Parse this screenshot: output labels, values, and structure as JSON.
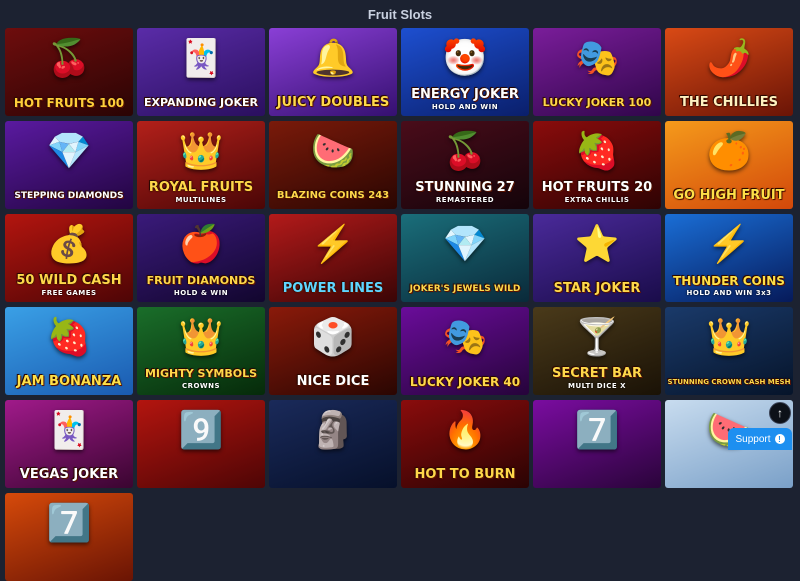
{
  "page": {
    "title": "Fruit Slots"
  },
  "games": [
    {
      "title": "HOT FRUITS 100",
      "subtitle": "",
      "icon": "🍒",
      "bg": "linear-gradient(160deg,#6e0d0d,#2a0404)",
      "color": "#ffcf3a"
    },
    {
      "title": "EXPANDING JOKER",
      "subtitle": "",
      "icon": "🃏",
      "bg": "linear-gradient(160deg,#5a2ca8,#2a0f5e)",
      "color": "#ffffff"
    },
    {
      "title": "JUICY DOUBLES",
      "subtitle": "",
      "icon": "🔔",
      "bg": "linear-gradient(160deg,#8a3fd6,#351070)",
      "color": "#ffd84a"
    },
    {
      "title": "ENERGY JOKER",
      "subtitle": "HOLD AND WIN",
      "icon": "🤡",
      "bg": "linear-gradient(160deg,#1d4fd0,#0a1f6b)",
      "color": "#ffffff"
    },
    {
      "title": "LUCKY JOKER 100",
      "subtitle": "",
      "icon": "🎭",
      "bg": "linear-gradient(160deg,#7a1d9a,#30064a)",
      "color": "#ffd84a"
    },
    {
      "title": "THE CHILLIES",
      "subtitle": "",
      "icon": "🌶️",
      "bg": "linear-gradient(160deg,#d94a15,#6a1406)",
      "color": "#fff2c0"
    },
    {
      "title": "STEPPING DIAMONDS",
      "subtitle": "",
      "icon": "💎",
      "bg": "linear-gradient(160deg,#5a1aa0,#220540)",
      "color": "#ffffff"
    },
    {
      "title": "ROYAL FRUITS",
      "subtitle": "MULTILINES",
      "icon": "👑",
      "bg": "linear-gradient(160deg,#b3201a,#4a0606)",
      "color": "#ffd84a"
    },
    {
      "title": "BLAZING COINS 243",
      "subtitle": "",
      "icon": "🍉",
      "bg": "linear-gradient(160deg,#7a1a0a,#2a0602)",
      "color": "#ffd84a"
    },
    {
      "title": "STUNNING 27",
      "subtitle": "REMASTERED",
      "icon": "🍒",
      "bg": "linear-gradient(160deg,#4a0c1a,#14040a)",
      "color": "#ffffff"
    },
    {
      "title": "HOT FRUITS 20",
      "subtitle": "EXTRA CHILLIS",
      "icon": "🍓",
      "bg": "linear-gradient(160deg,#8a0c0c,#2e0303)",
      "color": "#ffffff"
    },
    {
      "title": "GO HIGH FRUIT",
      "subtitle": "",
      "icon": "🍊",
      "bg": "linear-gradient(160deg,#f59a1b,#d2480a)",
      "color": "#ffe048"
    },
    {
      "title": "50 WILD CASH",
      "subtitle": "FREE GAMES",
      "icon": "💰",
      "bg": "linear-gradient(160deg,#b3150f,#4e0505)",
      "color": "#ffd84a"
    },
    {
      "title": "FRUIT DIAMONDS",
      "subtitle": "HOLD & WIN",
      "icon": "🍎",
      "bg": "linear-gradient(160deg,#3a1a7a,#12062e)",
      "color": "#ffd84a"
    },
    {
      "title": "POWER LINES",
      "subtitle": "",
      "icon": "⚡",
      "bg": "linear-gradient(160deg,#b31a1a,#3a0505)",
      "color": "#5fd6ff"
    },
    {
      "title": "JOKER'S JEWELS WILD",
      "subtitle": "",
      "icon": "💎",
      "bg": "linear-gradient(160deg,#1a6e7a,#0a2a3a)",
      "color": "#ffd84a"
    },
    {
      "title": "STAR JOKER",
      "subtitle": "",
      "icon": "⭐",
      "bg": "linear-gradient(160deg,#4a2a9a,#1a0c4a)",
      "color": "#ffd84a"
    },
    {
      "title": "THUNDER COINS",
      "subtitle": "HOLD AND WIN 3x3",
      "icon": "⚡",
      "bg": "linear-gradient(160deg,#1a6ed6,#061a5a)",
      "color": "#ffe048"
    },
    {
      "title": "JAM BONANZA",
      "subtitle": "",
      "icon": "🍓",
      "bg": "linear-gradient(160deg,#3aa0e6,#1a5ab0)",
      "color": "#ffe048"
    },
    {
      "title": "MIGHTY SYMBOLS",
      "subtitle": "CROWNS",
      "icon": "👑",
      "bg": "linear-gradient(160deg,#1a6e2a,#062a0a)",
      "color": "#ffd84a"
    },
    {
      "title": "NICE DICE",
      "subtitle": "",
      "icon": "🎲",
      "bg": "linear-gradient(160deg,#8a1a0a,#2a0602)",
      "color": "#ffffff"
    },
    {
      "title": "LUCKY JOKER 40",
      "subtitle": "",
      "icon": "🎭",
      "bg": "linear-gradient(160deg,#6a0c9a,#26043a)",
      "color": "#ffd84a"
    },
    {
      "title": "SECRET BAR",
      "subtitle": "MULTI DICE X",
      "icon": "🍸",
      "bg": "linear-gradient(160deg,#4a3a1a,#1a1206)",
      "color": "#ffd84a"
    },
    {
      "title": "STUNNING CROWN CASH MESH",
      "subtitle": "",
      "icon": "👑",
      "bg": "linear-gradient(160deg,#1a3a6a,#06142a)",
      "color": "#ffd84a"
    },
    {
      "title": "VEGAS JOKER",
      "subtitle": "",
      "icon": "🃏",
      "bg": "linear-gradient(160deg,#a01a8a,#3a0530)",
      "color": "#ffffff"
    },
    {
      "title": "",
      "subtitle": "",
      "icon": "9️⃣",
      "bg": "linear-gradient(160deg,#b3150f,#4e0505)",
      "color": "#ffd84a"
    },
    {
      "title": "",
      "subtitle": "",
      "icon": "🗿",
      "bg": "linear-gradient(160deg,#1a2a5a,#06102a)",
      "color": "#ffd84a"
    },
    {
      "title": "HOT TO BURN",
      "subtitle": "",
      "icon": "🔥",
      "bg": "linear-gradient(160deg,#8a0c0c,#2a0303)",
      "color": "#ffd84a"
    },
    {
      "title": "",
      "subtitle": "",
      "icon": "7️⃣",
      "bg": "linear-gradient(160deg,#7a0ca0,#2a043a)",
      "color": "#ffd84a"
    },
    {
      "title": "",
      "subtitle": "",
      "icon": "🍉",
      "bg": "linear-gradient(160deg,#c8dcef,#7aa0c8)",
      "color": "#ffd84a"
    },
    {
      "title": "",
      "subtitle": "",
      "icon": "7️⃣",
      "bg": "linear-gradient(160deg,#d64a0a,#6a1404)",
      "color": "#ffd84a"
    }
  ],
  "ui": {
    "scroll_top_icon": "↑",
    "support_label": "Support",
    "support_icon": "!"
  }
}
